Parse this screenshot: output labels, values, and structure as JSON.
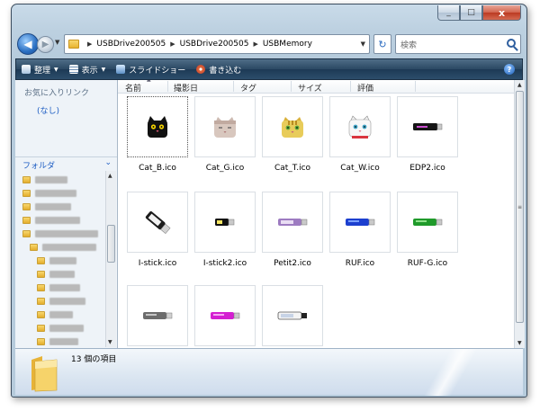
{
  "window": {
    "caption": {
      "minimize": "_",
      "maximize": "□",
      "close": "x"
    }
  },
  "address": {
    "breadcrumbs": [
      "USBDrive200505",
      "USBDrive200505",
      "USBMemory"
    ],
    "search_placeholder": "検索"
  },
  "command_bar": {
    "items": [
      {
        "label": "整理",
        "icon": "organize-icon",
        "has_dropdown": true
      },
      {
        "label": "表示",
        "icon": "views-icon",
        "has_dropdown": true
      },
      {
        "label": "スライドショー",
        "icon": "slideshow-icon",
        "has_dropdown": false
      },
      {
        "label": "書き込む",
        "icon": "burn-icon",
        "has_dropdown": false
      }
    ]
  },
  "nav_pane": {
    "favorites_title": "お気に入りリンク",
    "favorites_empty": "(なし)",
    "folders_title": "フォルダ"
  },
  "file_list": {
    "columns": [
      "名前",
      "撮影日",
      "タグ",
      "サイズ",
      "評価"
    ],
    "files": [
      {
        "name": "Cat_B.ico",
        "icon": "black-cat-icon",
        "selected": true
      },
      {
        "name": "Cat_G.ico",
        "icon": "gray-cat-icon"
      },
      {
        "name": "Cat_T.ico",
        "icon": "tabby-cat-icon"
      },
      {
        "name": "Cat_W.ico",
        "icon": "white-cat-icon"
      },
      {
        "name": "EDP2.ico",
        "icon": "usb-black-icon"
      },
      {
        "name": "I-stick.ico",
        "icon": "usb-stick-diagonal-icon"
      },
      {
        "name": "I-stick2.ico",
        "icon": "usb-stick-small-icon"
      },
      {
        "name": "Petit2.ico",
        "icon": "usb-purple-icon"
      },
      {
        "name": "RUF.ico",
        "icon": "usb-blue-icon"
      },
      {
        "name": "RUF-G.ico",
        "icon": "usb-green-icon"
      },
      {
        "name": "",
        "icon": "usb-gray-icon"
      },
      {
        "name": "",
        "icon": "usb-magenta-icon"
      },
      {
        "name": "",
        "icon": "usb-white-icon"
      }
    ]
  },
  "details": {
    "item_count": "13 個の項目"
  },
  "colors": {
    "accent": "#1c5cc3",
    "command_bar": "#2a4863"
  }
}
